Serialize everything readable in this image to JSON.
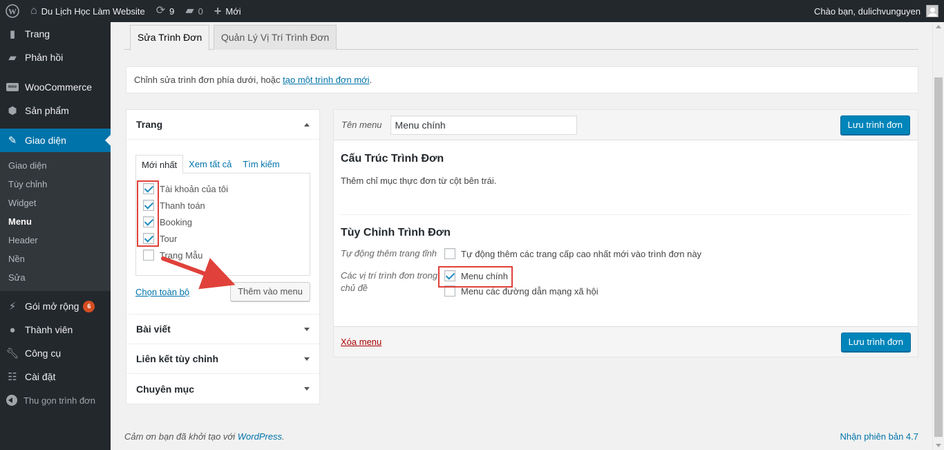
{
  "adminbar": {
    "site_name": "Du Lịch Học Làm Website",
    "updates_count": "9",
    "comments_count": "0",
    "new_label": "Mới",
    "greeting": "Chào bạn, dulichvunguyen"
  },
  "sidebar": {
    "top_items": [
      {
        "label": "Trang",
        "icon": "page-icon"
      },
      {
        "label": "Phản hồi",
        "icon": "comment-icon"
      },
      {
        "label": "WooCommerce",
        "icon": "woocommerce-icon"
      },
      {
        "label": "Sản phẩm",
        "icon": "product-icon"
      },
      {
        "label": "Giao diện",
        "icon": "appearance-icon"
      }
    ],
    "submenu": [
      "Giao diện",
      "Tùy chỉnh",
      "Widget",
      "Menu",
      "Header",
      "Nền",
      "Sửa"
    ],
    "bottom_items": [
      {
        "label": "Gói mở rộng",
        "icon": "plugin-icon",
        "badge": "6"
      },
      {
        "label": "Thành viên",
        "icon": "user-icon"
      },
      {
        "label": "Công cụ",
        "icon": "wrench-icon"
      },
      {
        "label": "Cài đặt",
        "icon": "settings-icon"
      }
    ],
    "collapse_label": "Thu gọn trình đơn"
  },
  "tabs": {
    "edit": "Sửa Trình Đơn",
    "locations": "Quản Lý Vị Trí Trình Đơn"
  },
  "notice": {
    "text": "Chỉnh sửa trình đơn phía dưới, hoặc ",
    "link": "tạo một trình đơn mới",
    "end": "."
  },
  "accordion": {
    "pages_title": "Trang",
    "inner_tabs": [
      "Mới nhất",
      "Xem tất cả",
      "Tìm kiếm"
    ],
    "items": [
      {
        "label": "Tài khoản của tôi",
        "checked": true
      },
      {
        "label": "Thanh toán",
        "checked": true
      },
      {
        "label": "Booking",
        "checked": true
      },
      {
        "label": "Tour",
        "checked": true
      },
      {
        "label": "Trang Mẫu",
        "checked": false
      }
    ],
    "select_all": "Chọn toàn bộ",
    "add_button": "Thêm vào menu",
    "sections": [
      "Bài viết",
      "Liên kết tùy chỉnh",
      "Chuyên mục"
    ]
  },
  "menu": {
    "name_label": "Tên menu",
    "name_value": "Menu chính",
    "save_label": "Lưu trình đơn",
    "structure_title": "Cấu Trúc Trình Đơn",
    "structure_text": "Thêm chỉ mục thực đơn từ cột bên trái.",
    "settings_title": "Tùy Chỉnh Trình Đơn",
    "auto_add_label": "Tự động thêm trang tĩnh",
    "auto_add_option": "Tự động thêm các trang cấp cao nhất mới vào trình đơn này",
    "locations_label": "Các vị trí trình đơn trong chủ đề",
    "locations": [
      {
        "label": "Menu chính",
        "checked": true
      },
      {
        "label": "Menu các đường dẫn mạng xã hội",
        "checked": false
      }
    ],
    "delete_label": "Xóa menu"
  },
  "footer": {
    "thanks_text": "Cảm ơn bạn đã khởi tạo với ",
    "wp_link": "WordPress",
    "thanks_end": ".",
    "version": "Nhận phiên bản 4.7"
  },
  "colors": {
    "admin_dark": "#23282d",
    "accent": "#0073aa",
    "primary_button": "#0085ba",
    "annotation_red": "#e0413a"
  }
}
